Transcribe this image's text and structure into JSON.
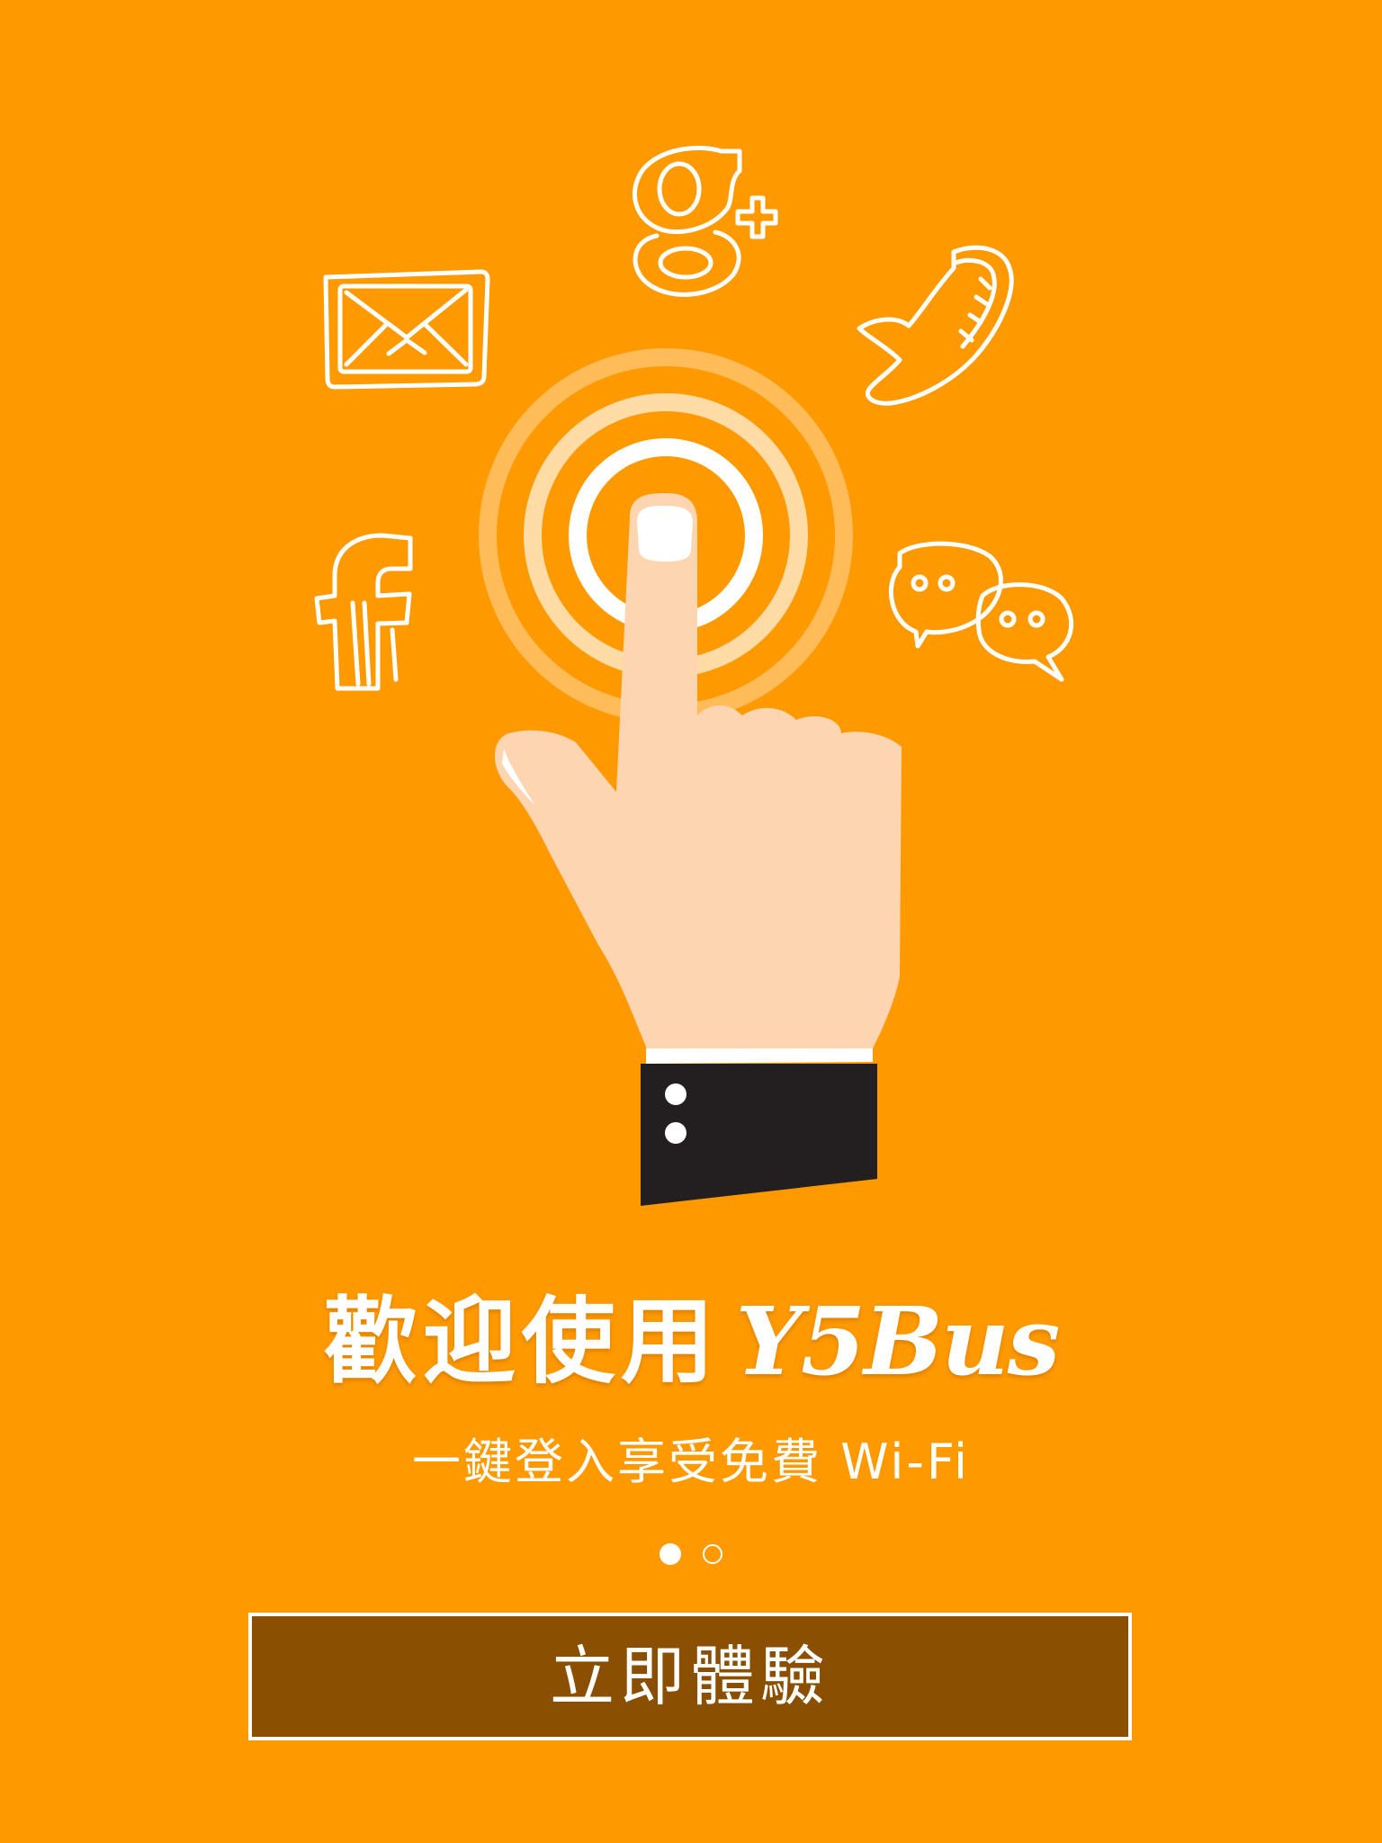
{
  "colors": {
    "background": "#FF9900",
    "button_fill": "#8A4F00",
    "text": "#FFFFFF",
    "hand": "#FDD5B1",
    "cuff": "#231F20"
  },
  "icons": [
    "google-plus-icon",
    "mail-icon",
    "phone-icon",
    "facebook-icon",
    "chat-bubbles-icon",
    "tap-ripple-icon",
    "pointing-hand-icon"
  ],
  "welcome": {
    "title_zh": "歡迎使用",
    "title_brand": "Y5Bus",
    "subtitle": "一鍵登入享受免費 Wi-Fi"
  },
  "pager": {
    "total": 2,
    "current": 1
  },
  "cta": {
    "label": "立即體驗"
  }
}
